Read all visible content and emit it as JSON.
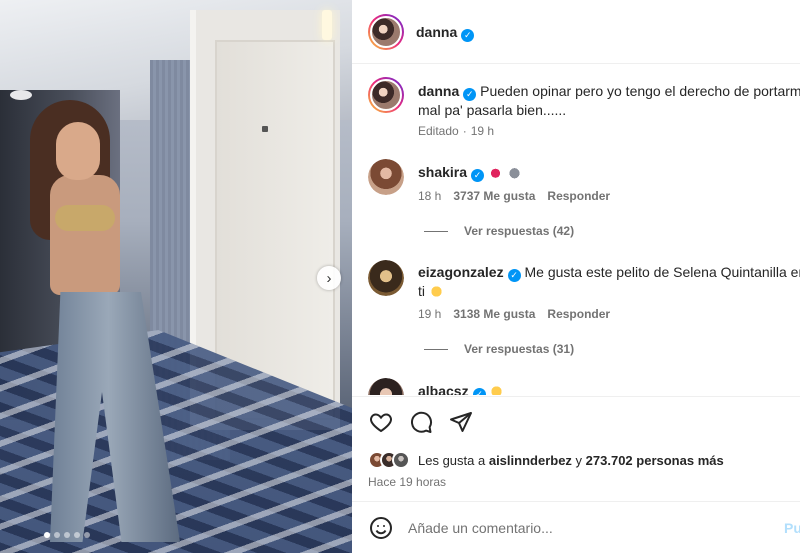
{
  "post_author": {
    "username": "danna",
    "verified": true
  },
  "caption": {
    "username": "danna",
    "text_line1": "Pueden opinar pero yo tengo el derecho de portarm",
    "text_line2": "mal pa' pasarla bien......",
    "edited_label": "Editado",
    "separator": "·",
    "time": "19 h"
  },
  "comments": [
    {
      "username": "shakira",
      "verified": true,
      "emojis": [
        "kiss-mark-icon",
        "wolf-face-icon"
      ],
      "time": "18 h",
      "likes": "3737 Me gusta",
      "reply_label": "Responder",
      "view_replies": "Ver respuestas (42)"
    },
    {
      "username": "eizagonzalez",
      "verified": true,
      "text_line1": "Me gusta este pelito de Selena Quintanilla en",
      "text_line2": "ti",
      "emojis": [
        "heart-eyes-icon"
      ],
      "time": "19 h",
      "likes": "3138 Me gusta",
      "reply_label": "Responder",
      "view_replies": "Ver respuestas (31)"
    },
    {
      "username": "albacsz",
      "verified": true,
      "emojis": [
        "heart-eyes-icon"
      ]
    }
  ],
  "likes": {
    "prefix": "Les gusta a",
    "user": "aislinnderbez",
    "middle": "y",
    "count": "273.702 personas más"
  },
  "posted_ago": "Hace 19 horas",
  "add_comment": {
    "placeholder": "Añade un comentario...",
    "post_label": "Pu"
  },
  "carousel": {
    "next_symbol": "›",
    "dots": 5,
    "active_dot": 1
  },
  "colors": {
    "verified": "#0095f6",
    "meta_text": "#737373",
    "post_button": "#b2dffc",
    "story_ring_start": "#f9ce34",
    "story_ring_end": "#6228d7"
  }
}
